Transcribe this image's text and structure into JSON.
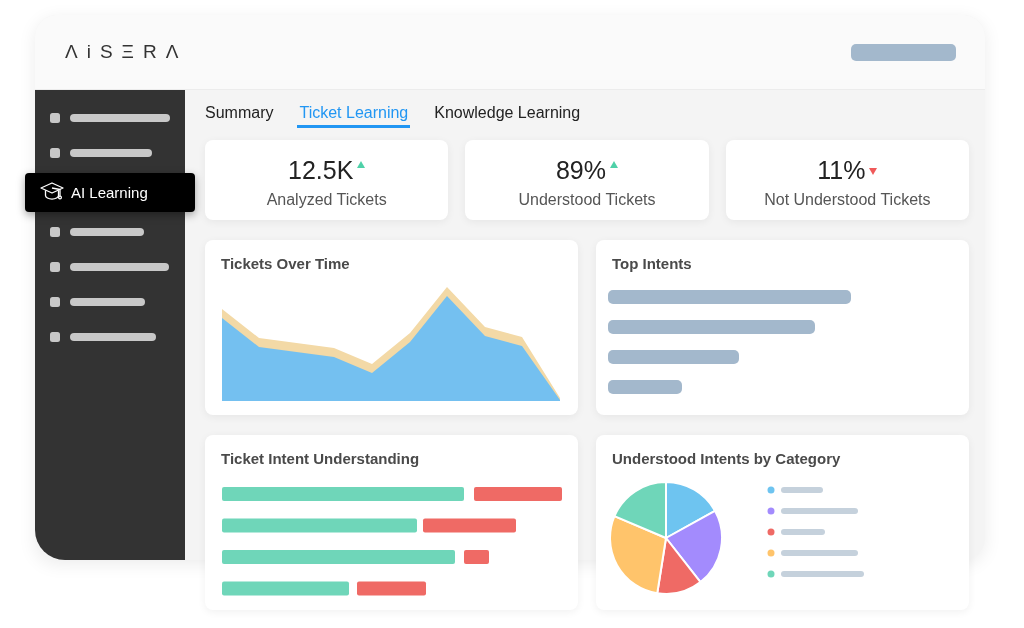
{
  "header": {
    "logo": "ΛiSΞRΛ"
  },
  "sidebar": {
    "items": [
      {
        "kind": "skeleton"
      },
      {
        "kind": "skeleton"
      },
      {
        "kind": "link",
        "label": "AI Learning",
        "selected": true
      },
      {
        "kind": "skeleton"
      },
      {
        "kind": "skeleton"
      },
      {
        "kind": "skeleton"
      },
      {
        "kind": "skeleton"
      }
    ]
  },
  "tabs": [
    {
      "label": "Summary",
      "selected": false
    },
    {
      "label": "Ticket Learning",
      "selected": true
    },
    {
      "label": "Knowledge Learning",
      "selected": false
    }
  ],
  "stats": [
    {
      "value": "12.5K",
      "label": "Analyzed Tickets",
      "rising": true
    },
    {
      "value": "89%",
      "label": "Understood Tickets",
      "rising": true
    },
    {
      "value": "11%",
      "label": "Not Understood Tickets",
      "rising": false
    }
  ],
  "panels": [
    {
      "kind": "area",
      "title": "Tickets Over Time"
    },
    {
      "kind": "bars",
      "title": "Top Intents"
    },
    {
      "kind": "split-bars",
      "title": "Ticket Intent Understanding"
    },
    {
      "kind": "pie",
      "title": "Understood Intents by Category"
    }
  ]
}
